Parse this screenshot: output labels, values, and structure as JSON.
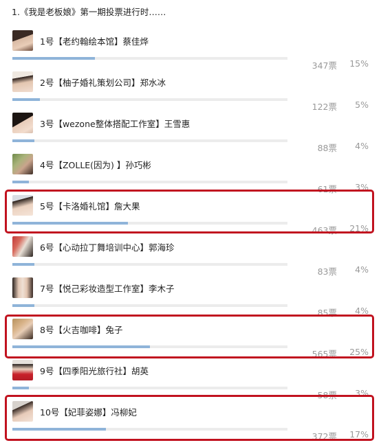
{
  "header": {
    "title": "1.《我是老板娘》第一期投票进行时……"
  },
  "accent_color": "#8fb4d9",
  "highlight_color": "#c1121f",
  "candidates": [
    {
      "name": "1号【老约翰绘本馆】蔡佳烨",
      "votes": "347票",
      "percent": "15%",
      "share": 0.15,
      "highlighted": false
    },
    {
      "name": "2号【柚子婚礼策划公司】郑水冰",
      "votes": "122票",
      "percent": "5%",
      "share": 0.05,
      "highlighted": false
    },
    {
      "name": "3号【wezone整体搭配工作室】王雪惠",
      "votes": "88票",
      "percent": "4%",
      "share": 0.04,
      "highlighted": false
    },
    {
      "name": "4号【ZOLLE(因为) 】孙巧彬",
      "votes": "61票",
      "percent": "3%",
      "share": 0.03,
      "highlighted": false
    },
    {
      "name": "5号【卡洛婚礼馆】詹大果",
      "votes": "463票",
      "percent": "21%",
      "share": 0.21,
      "highlighted": true
    },
    {
      "name": "6号【心动拉丁舞培训中心】郭海珍",
      "votes": "83票",
      "percent": "4%",
      "share": 0.04,
      "highlighted": false
    },
    {
      "name": "7号【悦己彩妆造型工作室】李木子",
      "votes": "85票",
      "percent": "4%",
      "share": 0.04,
      "highlighted": false
    },
    {
      "name": "8号【火吉咖啡】兔子",
      "votes": "565票",
      "percent": "25%",
      "share": 0.25,
      "highlighted": true
    },
    {
      "name": "9号【四季阳光旅行社】胡英",
      "votes": "58票",
      "percent": "3%",
      "share": 0.03,
      "highlighted": false
    },
    {
      "name": "10号【妃菲姿娜】冯柳妃",
      "votes": "372票",
      "percent": "17%",
      "share": 0.17,
      "highlighted": true
    }
  ]
}
